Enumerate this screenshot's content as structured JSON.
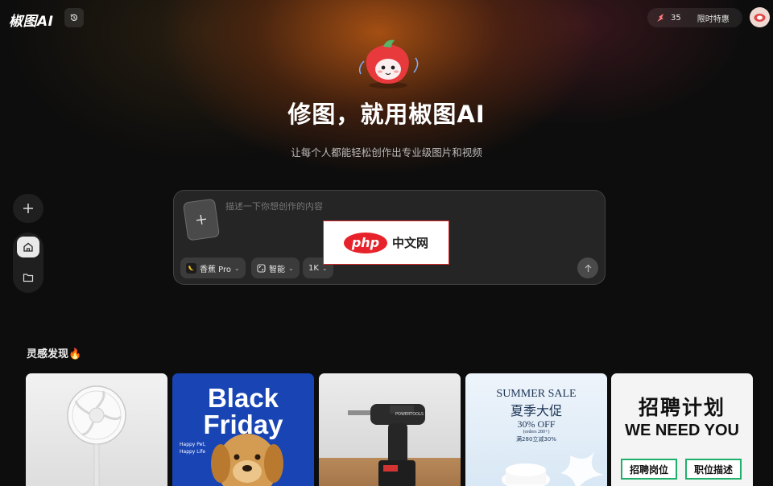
{
  "header": {
    "logo": "椒图AI",
    "credits": "35",
    "promo": "限时特惠"
  },
  "hero": {
    "title": "修图，就用椒图AI",
    "subtitle": "让每个人都能轻松创作出专业级图片和视频"
  },
  "composer": {
    "placeholder": "描述一下你想创作的内容",
    "model": "香蕉 Pro",
    "ratio": "智能",
    "resolution": "1K"
  },
  "watermark": {
    "badge": "php",
    "text": "中文网"
  },
  "inspiration": {
    "title": "灵感发现🔥",
    "cards": [
      {
        "kind": "fan"
      },
      {
        "kind": "poster",
        "title": "Black Friday",
        "small": "Happy Pet, Happy Life"
      },
      {
        "kind": "drill",
        "brand": "POWERTOOLS"
      },
      {
        "kind": "sale",
        "en": "SUMMER SALE",
        "cn": "夏季大促",
        "off": "30% OFF",
        "note": "(orders 280+)",
        "cn_note": "满280立减30%"
      },
      {
        "kind": "recruit",
        "title": "招聘计划",
        "en": "WE NEED YOU",
        "box1": "招聘岗位",
        "box2": "职位描述"
      }
    ]
  },
  "icons": {
    "history": "history-icon",
    "credit": "pepper-spark-icon",
    "add": "plus-icon",
    "home": "home-icon",
    "folder": "folder-icon",
    "send": "arrow-up-icon",
    "model": "banana-icon",
    "ratio": "aspect-ratio-icon"
  },
  "colors": {
    "accent_glow": "#be5a14",
    "background": "#0d0d0d",
    "watermark_red": "#e8222a"
  }
}
